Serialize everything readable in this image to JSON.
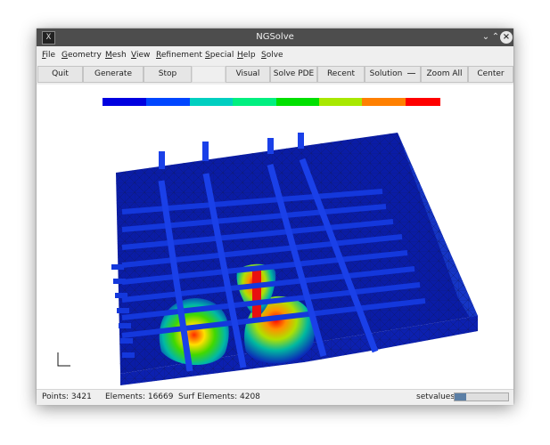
{
  "window": {
    "title": "NGSolve",
    "icon_glyph": "X"
  },
  "menubar": {
    "items": [
      {
        "label": "File",
        "accel": "F",
        "rest": "ile"
      },
      {
        "label": "Geometry",
        "accel": "G",
        "rest": "eometry"
      },
      {
        "label": "Mesh",
        "accel": "M",
        "rest": "esh"
      },
      {
        "label": "View",
        "accel": "V",
        "rest": "iew"
      },
      {
        "label": "Refinement",
        "accel": "R",
        "rest": "efinement"
      },
      {
        "label": "Special",
        "accel": "S",
        "rest": "pecial"
      },
      {
        "label": "Help",
        "accel": "H",
        "rest": "elp"
      },
      {
        "label": "Solve",
        "accel": "S",
        "rest": "olve"
      }
    ]
  },
  "toolbar": {
    "quit": "Quit",
    "generate_mesh": "Generate Mesh",
    "stop": "Stop",
    "visual": "Visual",
    "solve_pde": "Solve PDE",
    "recent": "Recent",
    "solution": "Solution",
    "zoom_all": "Zoom All",
    "center": "Center"
  },
  "colorbar": {
    "colors": [
      "#0000e0",
      "#0046ff",
      "#00cfc0",
      "#00ef80",
      "#00e000",
      "#a8e800",
      "#ff8000",
      "#ff0000"
    ]
  },
  "viewport": {
    "axes_icon": "axes-icon"
  },
  "status": {
    "points": "Points: 3421",
    "elements": "Elements: 16669",
    "surf_elements": "Surf Elements: 4208",
    "progress_label": "setvalues",
    "progress_fraction": 0.22
  }
}
